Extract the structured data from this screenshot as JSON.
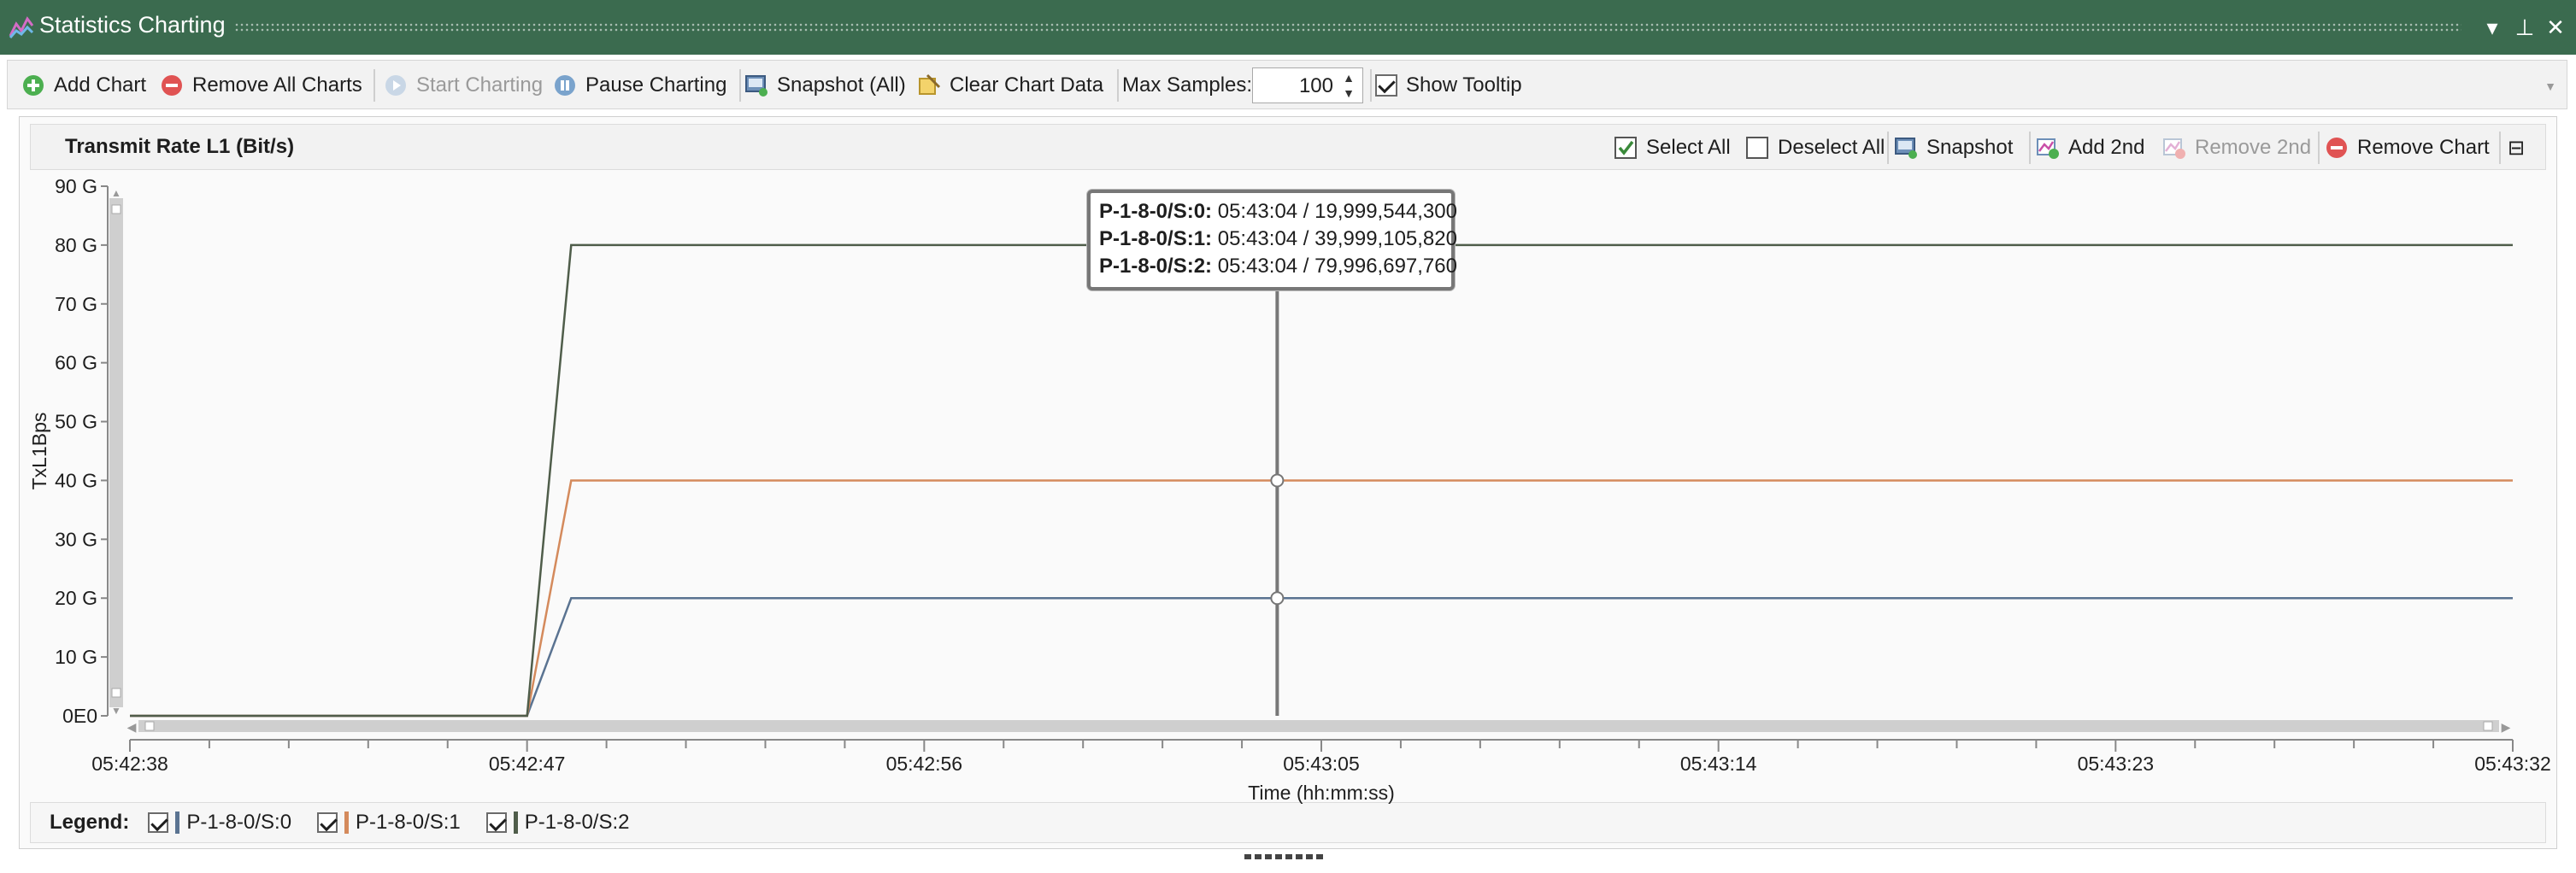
{
  "window": {
    "title": "Statistics Charting",
    "buttons": [
      "▾",
      "⊥",
      "✕"
    ]
  },
  "toolbar": {
    "add_chart": "Add Chart",
    "remove_all_charts": "Remove All Charts",
    "start_charting": "Start Charting",
    "pause_charting": "Pause Charting",
    "snapshot_all": "Snapshot (All)",
    "clear_chart_data": "Clear Chart Data",
    "max_samples_label": "Max Samples:",
    "max_samples_value": "100",
    "show_tooltip": "Show Tooltip",
    "show_tooltip_checked": true
  },
  "chart": {
    "title": "Transmit Rate L1 (Bit/s)",
    "select_all": "Select All",
    "deselect_all": "Deselect All",
    "snapshot": "Snapshot",
    "add_2nd": "Add 2nd",
    "remove_2nd": "Remove 2nd",
    "remove_chart": "Remove Chart",
    "collapse_icon": "⊟"
  },
  "tooltip": [
    {
      "label": "P-1-8-0/S:0:",
      "value": "05:43:04 / 19,999,544,300"
    },
    {
      "label": "P-1-8-0/S:1:",
      "value": "05:43:04 / 39,999,105,820"
    },
    {
      "label": "P-1-8-0/S:2:",
      "value": "05:43:04 / 79,996,697,760"
    }
  ],
  "legend": {
    "title": "Legend:",
    "items": [
      {
        "name": "P-1-8-0/S:0",
        "color": "#5a7391",
        "checked": true
      },
      {
        "name": "P-1-8-0/S:1",
        "color": "#d48a5c",
        "checked": true
      },
      {
        "name": "P-1-8-0/S:2",
        "color": "#4f5d4a",
        "checked": true
      }
    ]
  },
  "colors": {
    "titlebar": "#3b6b4f",
    "series0": "#5a7391",
    "series1": "#d48a5c",
    "series2": "#4f5d4a"
  },
  "chart_data": {
    "type": "line",
    "title": "Transmit Rate L1 (Bit/s)",
    "xlabel": "Time (hh:mm:ss)",
    "ylabel": "TxL1Bps",
    "x_ticks": [
      "05:42:38",
      "05:42:47",
      "05:42:56",
      "05:43:05",
      "05:43:14",
      "05:43:23",
      "05:43:32"
    ],
    "y_ticks": [
      "0E0",
      "10 G",
      "20 G",
      "30 G",
      "40 G",
      "50 G",
      "60 G",
      "70 G",
      "80 G",
      "90 G"
    ],
    "ylim": [
      0,
      90000000000
    ],
    "xlim": [
      "05:42:38",
      "05:43:32"
    ],
    "grid": false,
    "cursor_x": "05:43:04",
    "series": [
      {
        "name": "P-1-8-0/S:0",
        "points": [
          [
            "05:42:38",
            0
          ],
          [
            "05:42:47",
            0
          ],
          [
            "05:42:48",
            19999544300
          ],
          [
            "05:43:32",
            19999544300
          ]
        ]
      },
      {
        "name": "P-1-8-0/S:1",
        "points": [
          [
            "05:42:38",
            0
          ],
          [
            "05:42:47",
            0
          ],
          [
            "05:42:48",
            39999105820
          ],
          [
            "05:43:32",
            39999105820
          ]
        ]
      },
      {
        "name": "P-1-8-0/S:2",
        "points": [
          [
            "05:42:38",
            0
          ],
          [
            "05:42:47",
            0
          ],
          [
            "05:42:48",
            79996697760
          ],
          [
            "05:43:32",
            79996697760
          ]
        ]
      }
    ]
  }
}
